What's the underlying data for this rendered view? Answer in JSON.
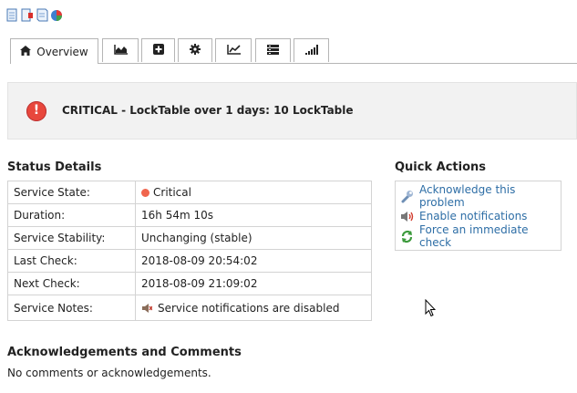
{
  "tabs": [
    {
      "label": "Overview",
      "icon": "home-icon",
      "active": true
    },
    {
      "label": "",
      "icon": "area-chart-icon"
    },
    {
      "label": "",
      "icon": "plus-square-icon"
    },
    {
      "label": "",
      "icon": "gear-icon"
    },
    {
      "label": "",
      "icon": "line-chart-icon"
    },
    {
      "label": "",
      "icon": "list-icon"
    },
    {
      "label": "",
      "icon": "signal-bars-icon"
    }
  ],
  "banner": {
    "status_icon": "critical-icon",
    "message": "CRITICAL - LockTable over 1 days: 10 LockTable"
  },
  "status_details": {
    "title": "Status Details",
    "rows": [
      {
        "key": "Service State:",
        "value": "Critical"
      },
      {
        "key": "Duration:",
        "value": "16h 54m 10s"
      },
      {
        "key": "Service Stability:",
        "value": "Unchanging (stable)"
      },
      {
        "key": "Last Check:",
        "value": "2018-08-09 20:54:02"
      },
      {
        "key": "Next Check:",
        "value": "2018-08-09 21:09:02"
      },
      {
        "key": "Service Notes:",
        "value": "Service notifications are disabled"
      }
    ],
    "critical_color": "#f0654d"
  },
  "quick_actions": {
    "title": "Quick Actions",
    "items": [
      {
        "label": "Acknowledge this problem",
        "icon": "wrench-icon"
      },
      {
        "label": "Enable notifications",
        "icon": "speaker-icon"
      },
      {
        "label": "Force an immediate check",
        "icon": "refresh-icon"
      }
    ],
    "link_color": "#2e6ea6"
  },
  "acknowledgements": {
    "title": "Acknowledgements and Comments",
    "text": "No comments or acknowledgements."
  }
}
